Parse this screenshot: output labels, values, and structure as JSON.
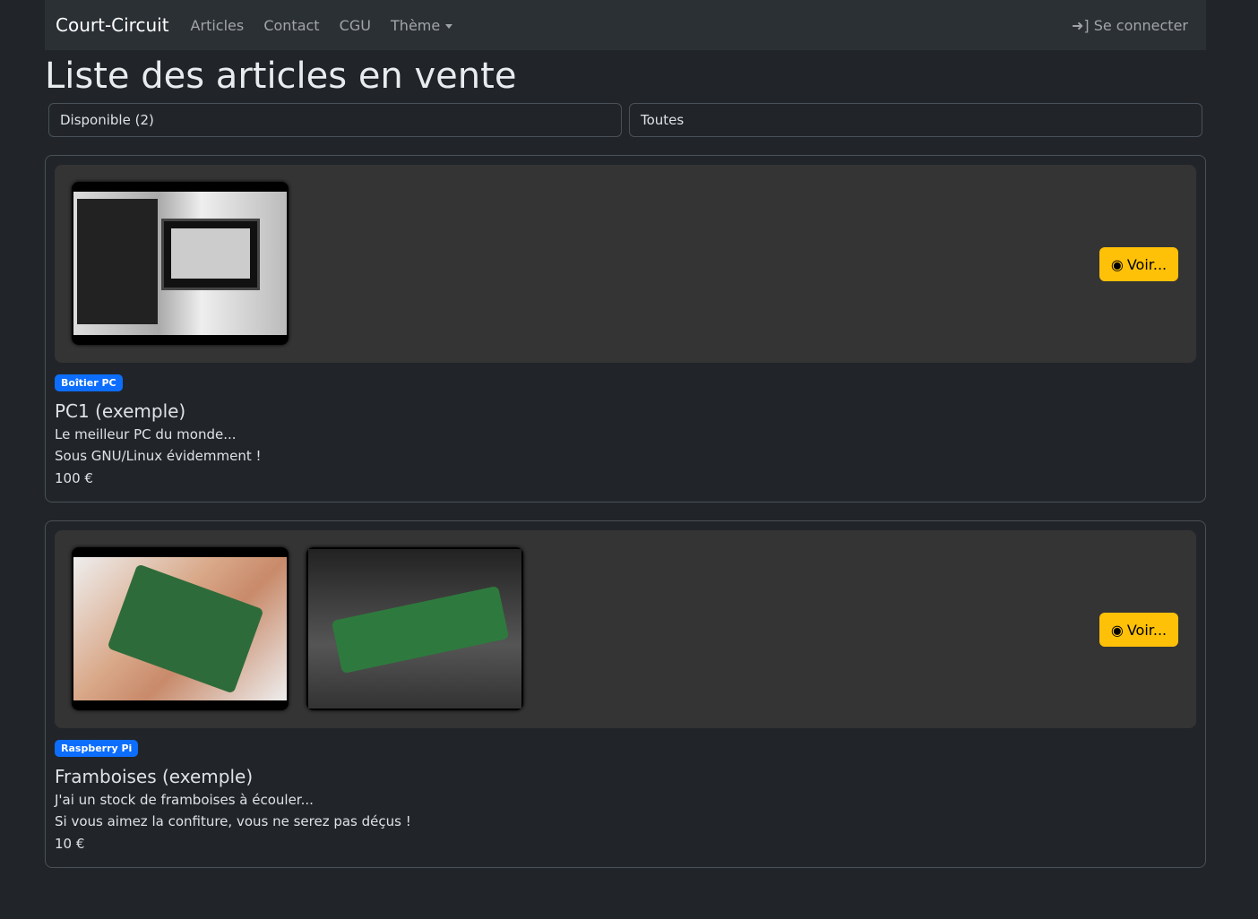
{
  "nav": {
    "brand": "Court-Circuit",
    "links": [
      "Articles",
      "Contact",
      "CGU",
      "Thème"
    ],
    "login": "Se connecter"
  },
  "page": {
    "title": "Liste des articles en vente"
  },
  "filters": {
    "status": "Disponible (2)",
    "category": "Toutes"
  },
  "articles": [
    {
      "category": "Boîtier PC",
      "title": "PC1 (exemple)",
      "lines": [
        "Le meilleur PC du monde...",
        "Sous GNU/Linux évidemment !"
      ],
      "price": "100 €",
      "button": "Voir..."
    },
    {
      "category": "Raspberry Pi",
      "title": "Framboises (exemple)",
      "lines": [
        "J'ai un stock de framboises à écouler...",
        "Si vous aimez la confiture, vous ne serez pas déçus !"
      ],
      "price": "10 €",
      "button": "Voir..."
    }
  ],
  "colors": {
    "accent": "#ffc107",
    "badge": "#0d6efd"
  }
}
